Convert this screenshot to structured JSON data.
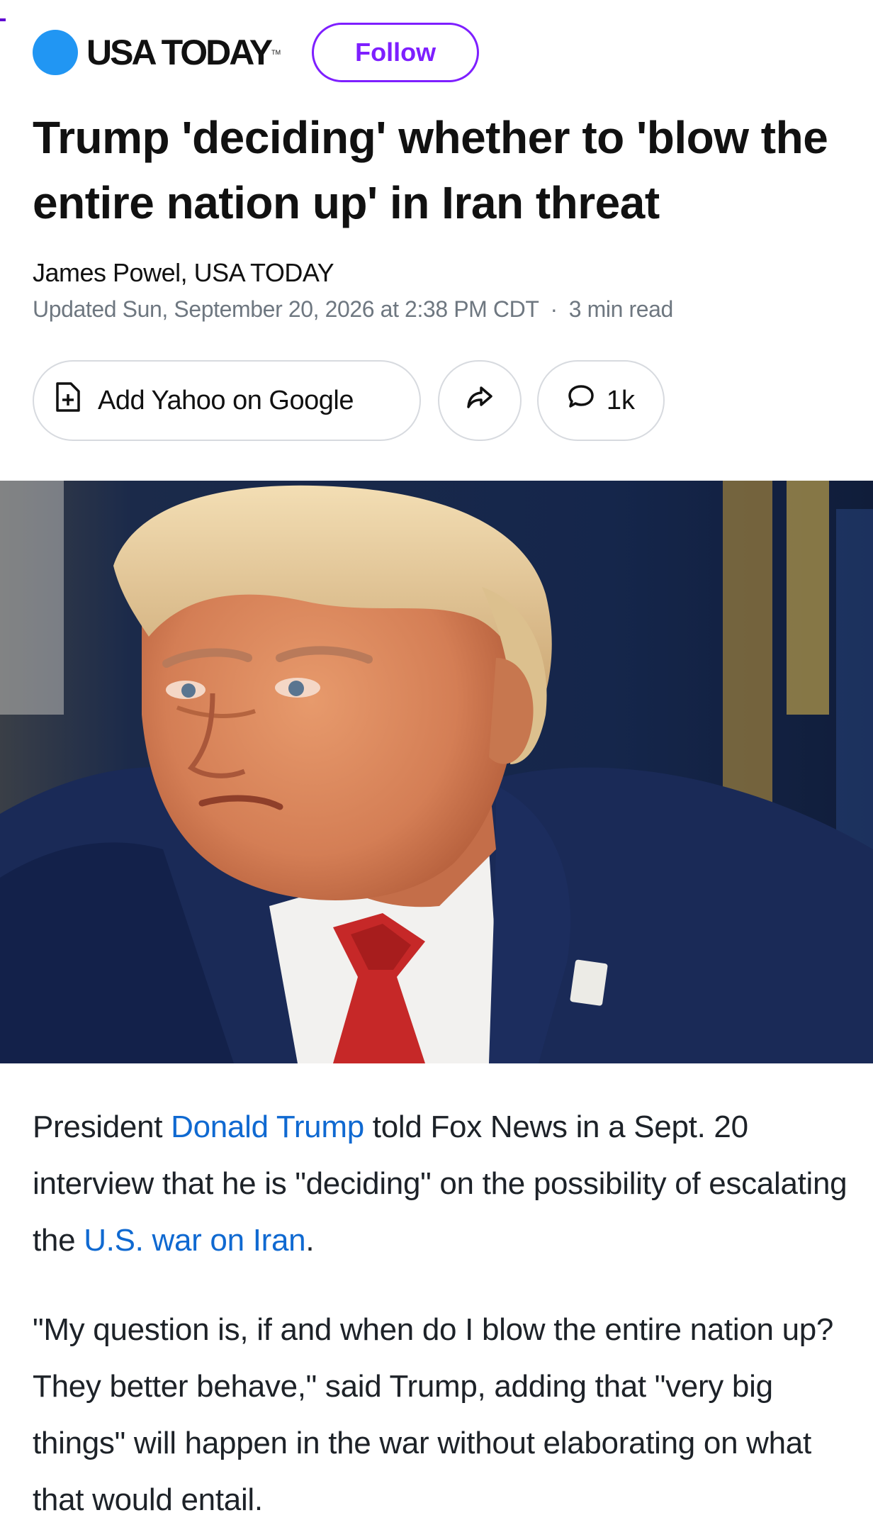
{
  "publisher": {
    "name": "USA TODAY",
    "trademark": "TM",
    "follow_label": "Follow"
  },
  "headline": "Trump 'deciding' whether to 'blow the entire nation up' in Iran threat",
  "byline": "James Powel, USA TODAY",
  "meta": {
    "updated": "Updated Sun, September 20, 2026 at 2:38 PM CDT",
    "separator": "·",
    "read_time": "3 min read"
  },
  "actions": {
    "add_google_label": "Add Yahoo on Google",
    "add_google_icon": "add-document-icon",
    "share_icon": "share-arrow-icon",
    "comments_icon": "comment-bubble-icon",
    "comments_count": "1k"
  },
  "colors": {
    "accent_purple": "#7e1fff",
    "brand_blue": "#2196f3",
    "link_blue": "#0f69d1",
    "meta_gray": "#6e7780"
  },
  "article": {
    "p1": {
      "t1": "President ",
      "link1": "Donald Trump",
      "t2": " told Fox News in a Sept. 20 interview that he is \"deciding\" on the possibility of escalating the ",
      "link2": "U.S. war on Iran",
      "t3": "."
    },
    "p2": "\"My question is, if and when do I blow the entire nation up? They better behave,\" said Trump, adding that \"very big things\" will happen in the war without elaborating on what that would entail."
  }
}
